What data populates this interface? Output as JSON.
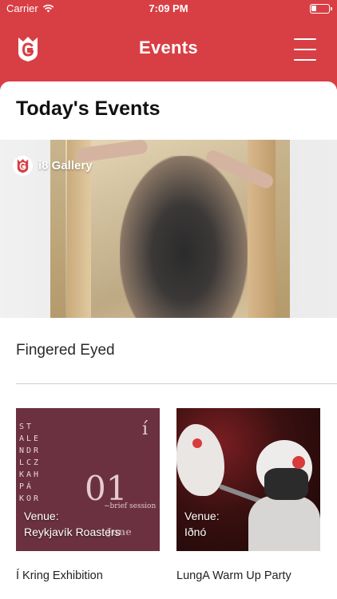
{
  "status_bar": {
    "carrier": "Carrier",
    "time": "7:09 PM"
  },
  "header": {
    "title": "Events",
    "logo_icon": "crowned-g-logo-icon",
    "menu_icon": "hamburger-menu-icon"
  },
  "colors": {
    "brand_red": "#d83f45",
    "text_dark": "#111111"
  },
  "section": {
    "title": "Today's Events"
  },
  "featured": {
    "venue": "i8 Gallery",
    "event_title": "Fingered Eyed"
  },
  "cards": [
    {
      "venue_label": "Venue:",
      "venue_name": "Reykjavík Roasters",
      "title": "Í Kring Exhibition",
      "artwork": {
        "letters": [
          "ST",
          "ALE",
          "NDR",
          "LCZ",
          "KAH",
          "PÁ",
          "KOR"
        ],
        "number": "01",
        "brief": "~brief session",
        "letter_i": "í",
        "june": "June"
      }
    },
    {
      "venue_label": "Venue:",
      "venue_name": "Iðnó",
      "title": "LungA Warm Up Party"
    }
  ]
}
